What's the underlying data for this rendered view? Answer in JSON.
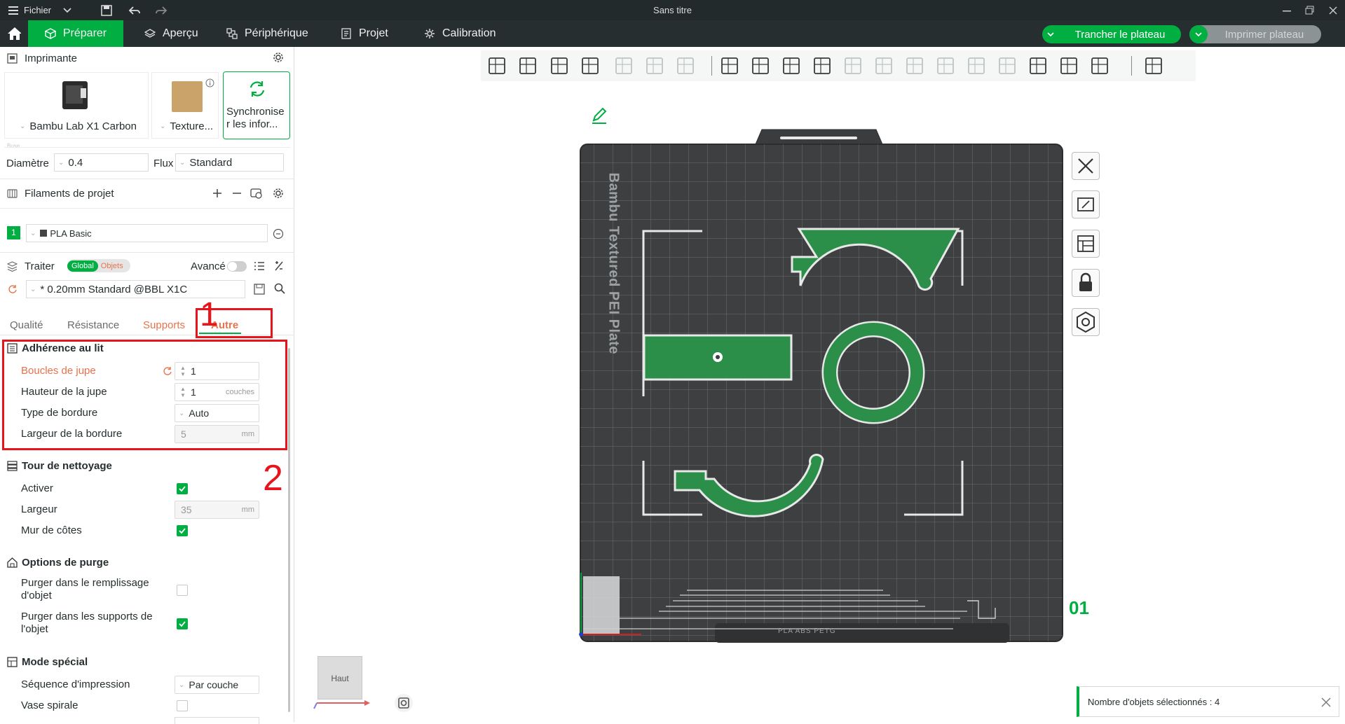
{
  "titlebar": {
    "menu_label": "Fichier",
    "title": "Sans titre"
  },
  "tabs": [
    {
      "label": "Préparer",
      "icon": "cube-icon"
    },
    {
      "label": "Aperçu",
      "icon": "layers-icon"
    },
    {
      "label": "Périphérique",
      "icon": "device-icon"
    },
    {
      "label": "Projet",
      "icon": "document-icon"
    },
    {
      "label": "Calibration",
      "icon": "calibration-icon"
    }
  ],
  "actions": {
    "slice": "Trancher le plateau",
    "print": "Imprimer plateau"
  },
  "printer": {
    "section_label": "Imprimante",
    "name": "Bambu Lab X1 Carbon",
    "plate": "Texture...",
    "sync": "Synchronise r les infor...",
    "nozzle_legend": "Buse",
    "diameter_label": "Diamètre",
    "diameter_value": "0.4",
    "flow_label": "Flux",
    "flow_value": "Standard"
  },
  "filaments": {
    "section_label": "Filaments de projet",
    "items": [
      {
        "index": "1",
        "name": "PLA Basic",
        "color": "#00ae42"
      }
    ]
  },
  "process": {
    "section_label": "Traiter",
    "toggle_global": "Global",
    "toggle_objects": "Objets",
    "advanced_label": "Avancé",
    "preset": "* 0.20mm Standard @BBL X1C",
    "tabs": [
      "Qualité",
      "Résistance",
      "Supports",
      "Autre"
    ],
    "active_tab": "Autre"
  },
  "annotations": {
    "one": "1",
    "two": "2"
  },
  "adhesion": {
    "title": "Adhérence au lit",
    "skirt_loops_label": "Boucles de jupe",
    "skirt_loops_value": "1",
    "skirt_height_label": "Hauteur de la jupe",
    "skirt_height_value": "1",
    "skirt_height_unit": "couches",
    "brim_type_label": "Type de bordure",
    "brim_type_value": "Auto",
    "brim_width_label": "Largeur de la bordure",
    "brim_width_value": "5",
    "brim_width_unit": "mm"
  },
  "prime_tower": {
    "title": "Tour de nettoyage",
    "enable_label": "Activer",
    "enable_checked": true,
    "width_label": "Largeur",
    "width_value": "35",
    "width_unit": "mm",
    "rib_label": "Mur de côtes",
    "rib_checked": true
  },
  "purge": {
    "title": "Options de purge",
    "infill_label": "Purger dans le remplissage d'objet",
    "infill_checked": false,
    "support_label": "Purger dans les supports de l'objet",
    "support_checked": true
  },
  "special": {
    "title": "Mode spécial",
    "sequence_label": "Séquence d'impression",
    "sequence_value": "Par couche",
    "vase_label": "Vase spirale",
    "vase_checked": false
  },
  "plate": {
    "bed_text": "Bambu Textured PEI Plate",
    "plate_number": "01",
    "bottom_label": "PLA ABS PETG"
  },
  "view_cube": {
    "label": "Haut"
  },
  "status": {
    "message": "Nombre d'objets sélectionnés : 4"
  },
  "colors": {
    "accent": "#00ae42",
    "annotation_red": "#e8141b",
    "bed": "#3d3f41",
    "object_green": "#2b8f4a"
  }
}
